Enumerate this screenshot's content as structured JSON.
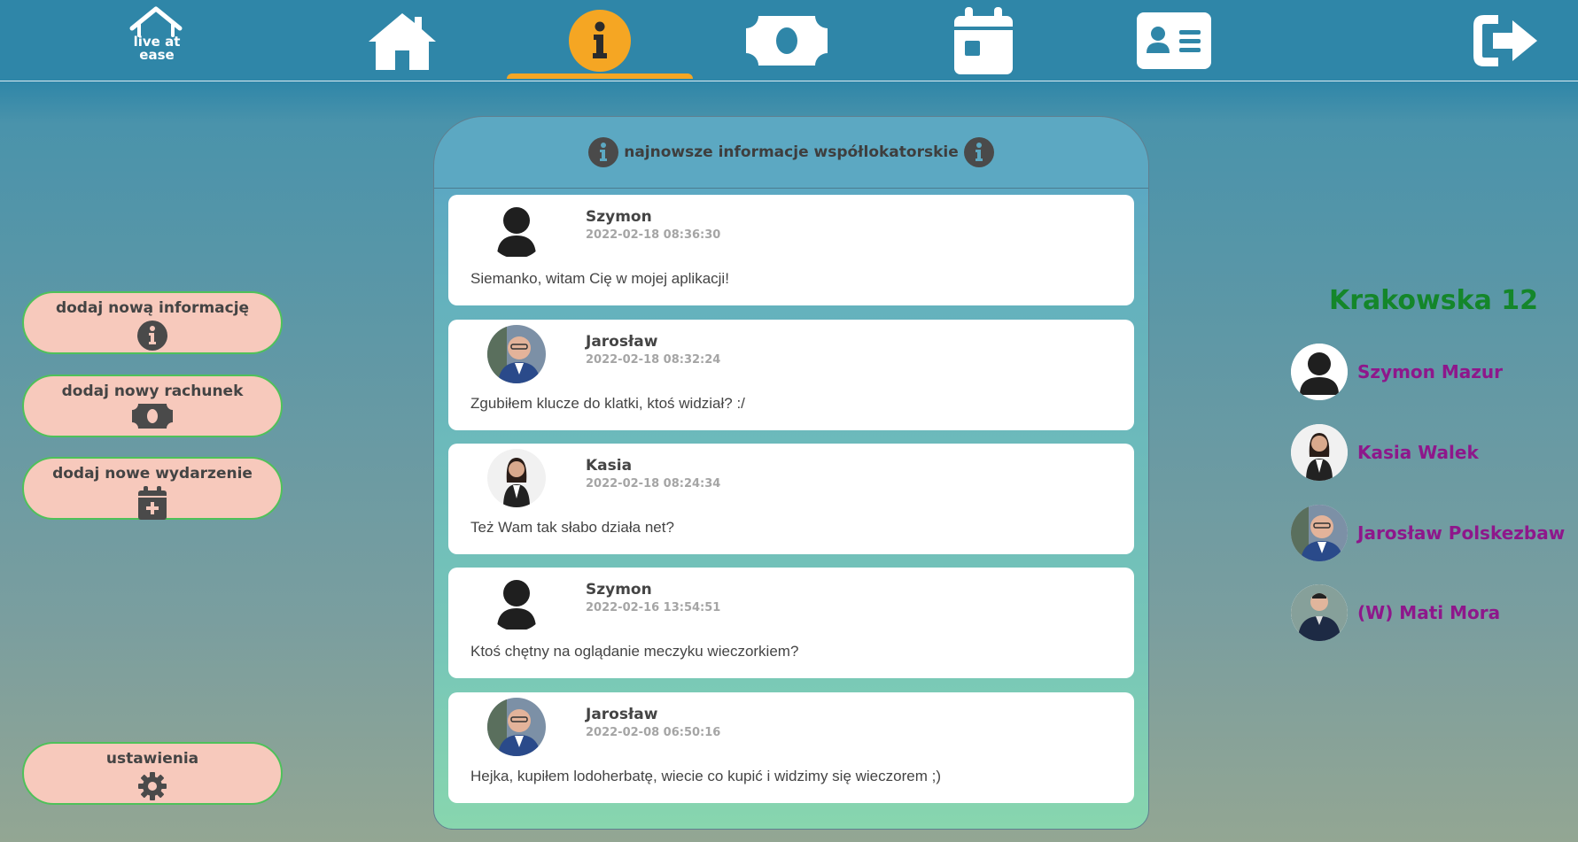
{
  "nav": {
    "logo_text_1": "live at",
    "logo_text_2": "ease",
    "items": [
      "home-icon",
      "info-icon",
      "money-icon",
      "calendar-icon",
      "contact-card-icon",
      "logout-icon"
    ],
    "active": "info-icon",
    "active_color": "#f5a623"
  },
  "sidebar": {
    "add_info_label": "dodaj nową informację",
    "add_bill_label": "dodaj nowy rachunek",
    "add_event_label": "dodaj nowe wydarzenie",
    "settings_label": "ustawienia"
  },
  "feed": {
    "title": "najnowsze informacje współlokatorskie",
    "posts": [
      {
        "author": "Szymon",
        "time": "2022-02-18 08:36:30",
        "message": "Siemanko, witam Cię w mojej aplikacji!",
        "avatar": "default-avatar"
      },
      {
        "author": "Jarosław",
        "time": "2022-02-18 08:32:24",
        "message": "Zgubiłem klucze do klatki, ktoś widział? :/",
        "avatar": "photo-avatar"
      },
      {
        "author": "Kasia",
        "time": "2022-02-18 08:24:34",
        "message": "Też Wam tak słabo działa net?",
        "avatar": "photo-avatar"
      },
      {
        "author": "Szymon",
        "time": "2022-02-16 13:54:51",
        "message": "Ktoś chętny na oglądanie meczyku wieczorkiem?",
        "avatar": "default-avatar"
      },
      {
        "author": "Jarosław",
        "time": "2022-02-08 06:50:16",
        "message": "Hejka, kupiłem lodoherbatę, wiecie co kupić i widzimy się wieczorem ;)",
        "avatar": "photo-avatar"
      }
    ]
  },
  "flat": {
    "address": "Krakowska 12",
    "members": [
      {
        "name": "Szymon Mazur"
      },
      {
        "name": "Kasia Walek"
      },
      {
        "name": "Jarosław Polskezbaw"
      },
      {
        "name": "(W) Mati Mora"
      }
    ]
  },
  "colors": {
    "nav_bg": "#2f86a8",
    "button_bg": "#f7c9bc",
    "button_border": "#4fc15a",
    "address": "#14862a",
    "member_name": "#8e178b"
  }
}
